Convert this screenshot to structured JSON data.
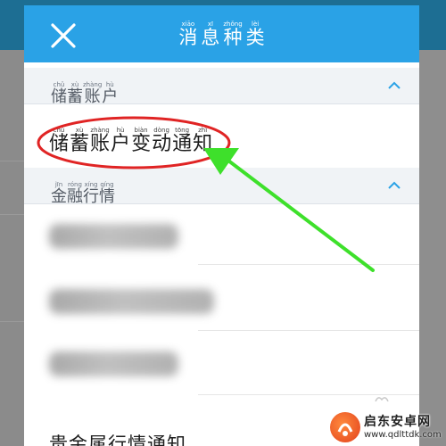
{
  "header": {
    "title": [
      {
        "hz": "消",
        "py": "xiāo"
      },
      {
        "hz": "息",
        "py": "xī"
      },
      {
        "hz": "种",
        "py": "zhǒng"
      },
      {
        "hz": "类",
        "py": "lèi"
      }
    ],
    "close_icon": "close-icon"
  },
  "sections": [
    {
      "label": [
        {
          "hz": "储",
          "py": "chǔ"
        },
        {
          "hz": "蓄",
          "py": "xù"
        },
        {
          "hz": "账",
          "py": "zhàng"
        },
        {
          "hz": "户",
          "py": "hù"
        }
      ],
      "caret_icon": "chevron-up-icon",
      "items": [
        {
          "text": [
            {
              "hz": "储",
              "py": "chǔ"
            },
            {
              "hz": "蓄",
              "py": "xù"
            },
            {
              "hz": "账",
              "py": "zhàng"
            },
            {
              "hz": "户",
              "py": "hù"
            },
            {
              "hz": "变",
              "py": "biàn"
            },
            {
              "hz": "动",
              "py": "dòng"
            },
            {
              "hz": "通",
              "py": "tōng"
            },
            {
              "hz": "知",
              "py": "zhī"
            }
          ]
        }
      ]
    },
    {
      "label": [
        {
          "hz": "金",
          "py": "jīn"
        },
        {
          "hz": "融",
          "py": "róng"
        },
        {
          "hz": "行",
          "py": "xíng"
        },
        {
          "hz": "情",
          "py": "qíng"
        }
      ],
      "caret_icon": "chevron-up-icon",
      "last_item": [
        {
          "hz": "贵",
          "py": ""
        },
        {
          "hz": "金",
          "py": ""
        },
        {
          "hz": "属",
          "py": ""
        },
        {
          "hz": "行",
          "py": ""
        },
        {
          "hz": "情",
          "py": ""
        },
        {
          "hz": "通",
          "py": ""
        },
        {
          "hz": "知",
          "py": ""
        }
      ]
    }
  ],
  "annotation": {
    "ellipse_color": "#e02424",
    "arrow_color": "#3ee02b"
  },
  "watermark": {
    "name": "启东安卓网",
    "url": "www.qdlttdk.com"
  }
}
